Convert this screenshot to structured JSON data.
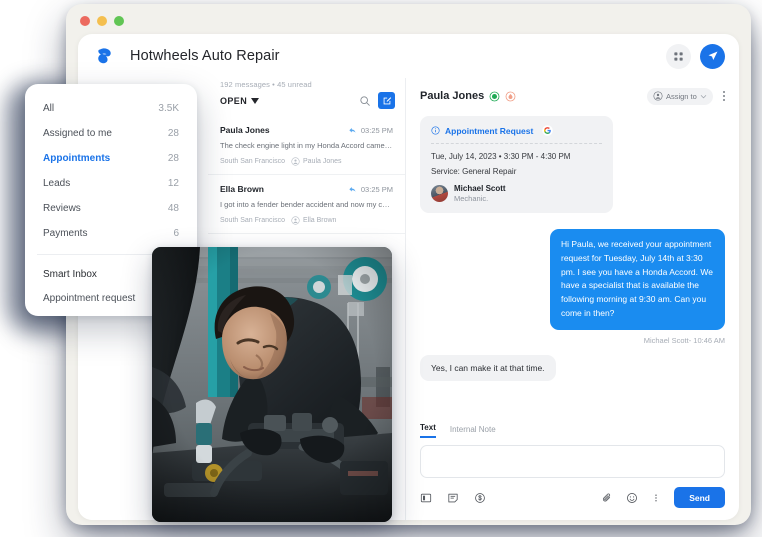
{
  "window": {
    "traffic_lights": [
      "close",
      "minimize",
      "maximize"
    ]
  },
  "appbar": {
    "brand_title": "Hotwheels Auto Repair",
    "logo_icon": "hotwheels-b-logo",
    "actions": [
      {
        "icon": "grid-apps-icon",
        "name": "apps-grid-button"
      },
      {
        "icon": "send-plane-icon",
        "name": "send-plane-button"
      }
    ]
  },
  "sidebar": {
    "items": [
      {
        "label": "All",
        "count": "3.5K",
        "active": false
      },
      {
        "label": "Assigned to me",
        "count": "28",
        "active": false
      },
      {
        "label": "Appointments",
        "count": "28",
        "active": true
      },
      {
        "label": "Leads",
        "count": "12",
        "active": false
      },
      {
        "label": "Reviews",
        "count": "48",
        "active": false
      },
      {
        "label": "Payments",
        "count": "6",
        "active": false
      }
    ],
    "sub_items": [
      {
        "label": "Smart Inbox"
      },
      {
        "label": "Appointment request"
      }
    ]
  },
  "conversation_list": {
    "meta": "192 messages • 45 unread",
    "filter_label": "OPEN",
    "search_icon": "search-icon",
    "compose_icon": "compose-icon",
    "items": [
      {
        "name": "Paula Jones",
        "time": "03:25 PM",
        "snippet": "The check engine light in my Honda Accord came on ...",
        "location": "South San Francisco",
        "assignee": "Paula Jones"
      },
      {
        "name": "Ella Brown",
        "time": "03:25 PM",
        "snippet": "I got into a fender bender accident and now my car is ...",
        "location": "South San Francisco",
        "assignee": "Ella Brown"
      }
    ]
  },
  "conversation": {
    "title": "Paula Jones",
    "badges": [
      "verified-green-badge",
      "alert-orange-badge"
    ],
    "assign_label": "Assign to",
    "assign_icon": "person-circle-icon",
    "kebab_icon": "more-vertical-icon",
    "appointment_card": {
      "header": "Appointment Request",
      "header_icon": "info-circle-icon",
      "source_icon": "google-g-icon",
      "when": "Tue, July 14, 2023 • 3:30 PM - 4:30 PM",
      "service": "Service:  General Repair",
      "person_name": "Michael Scott",
      "person_role": "Mechanic."
    },
    "messages": [
      {
        "direction": "outgoing",
        "text": "Hi Paula, we received your appointment request for Tuesday, July 14th at 3:30 pm. I see you have a Honda Accord. We have a specialist that is available the following morning at 9:30 am. Can you come in then?",
        "meta": "Michael Scott- 10:46 AM"
      },
      {
        "direction": "incoming",
        "text": "Yes, I can make it at that time."
      }
    ]
  },
  "composer": {
    "tabs": [
      {
        "label": "Text",
        "active": true
      },
      {
        "label": "Internal Note",
        "active": false
      }
    ],
    "input_value": "",
    "input_placeholder": "",
    "left_tools": [
      {
        "icon": "template-icon",
        "name": "insert-template-button"
      },
      {
        "icon": "note-edit-icon",
        "name": "insert-note-button"
      },
      {
        "icon": "payment-dollar-icon",
        "name": "request-payment-button"
      }
    ],
    "right_tools": [
      {
        "icon": "paperclip-icon",
        "name": "attach-file-button"
      },
      {
        "icon": "emoji-smiley-icon",
        "name": "emoji-button"
      },
      {
        "icon": "more-vertical-icon",
        "name": "composer-more-button"
      }
    ],
    "send_label": "Send"
  },
  "photo_card": {
    "alt": "mechanic-working-on-engine-photo"
  },
  "colors": {
    "accent_blue": "#1a73e8",
    "bubble_blue": "#1a8cf0",
    "surface_grey": "#f1f2f4",
    "window_chrome": "#f2f1ec"
  }
}
